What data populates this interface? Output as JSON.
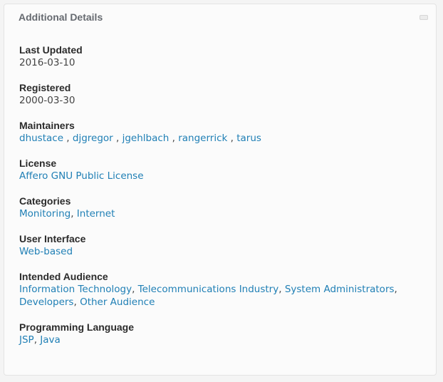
{
  "panel": {
    "title": "Additional Details",
    "collapse_icon": "minimize-icon"
  },
  "fields": {
    "last_updated": {
      "label": "Last Updated",
      "value": "2016-03-10"
    },
    "registered": {
      "label": "Registered",
      "value": "2000-03-30"
    },
    "maintainers": {
      "label": "Maintainers",
      "items": [
        "dhustace",
        "djgregor",
        "jgehlbach",
        "rangerrick",
        "tarus"
      ],
      "separator": " , "
    },
    "license": {
      "label": "License",
      "items": [
        "Affero GNU Public License"
      ]
    },
    "categories": {
      "label": "Categories",
      "items": [
        "Monitoring",
        "Internet"
      ],
      "separator": ", "
    },
    "user_interface": {
      "label": "User Interface",
      "items": [
        "Web-based"
      ]
    },
    "intended_audience": {
      "label": "Intended Audience",
      "items": [
        "Information Technology",
        "Telecommunications Industry",
        "System Administrators",
        "Developers",
        "Other Audience"
      ],
      "separator": ", "
    },
    "programming_language": {
      "label": "Programming Language",
      "items": [
        "JSP",
        "Java"
      ],
      "separator": ", "
    }
  },
  "colors": {
    "link": "#1f7fb5",
    "label": "#2b2b2b",
    "title": "#666a70",
    "panel_bg": "#fbfbfb",
    "page_bg": "#f4f4f4"
  }
}
